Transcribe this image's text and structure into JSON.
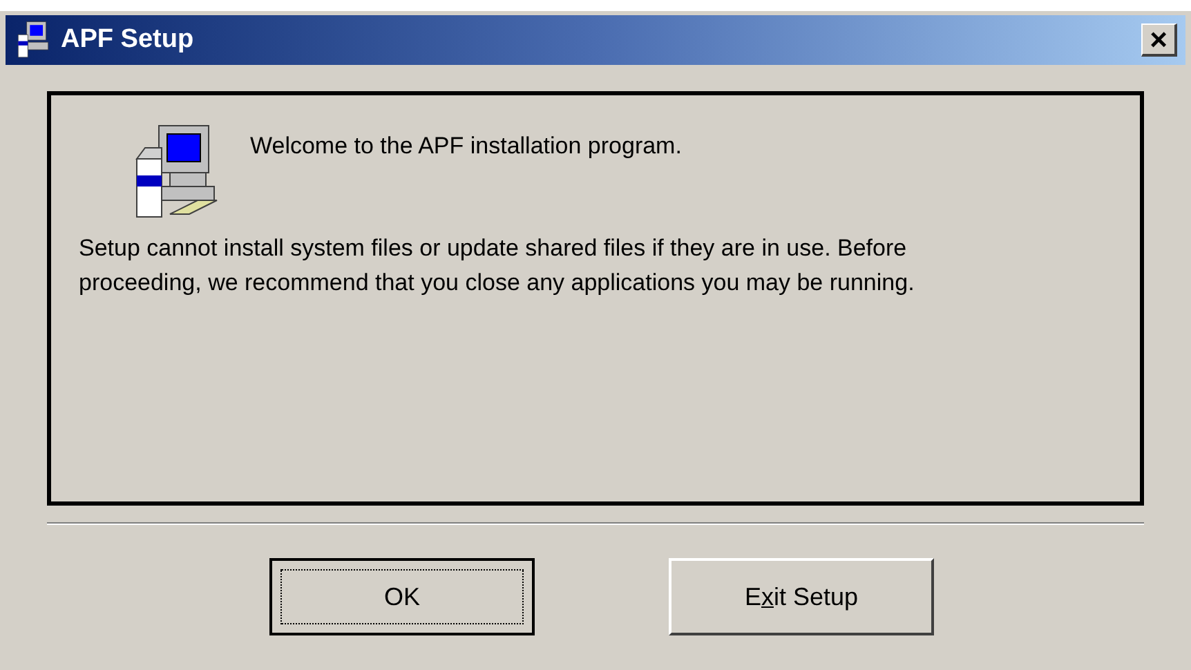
{
  "window": {
    "title": "APF Setup",
    "close": "×"
  },
  "welcome": "Welcome to the APF installation program.",
  "message": "Setup cannot install system files or update shared files if they are in use. Before proceeding, we recommend that you close any applications you may be running.",
  "buttons": [
    {
      "kind": "default",
      "label": "OK"
    },
    {
      "kind": "accelerator",
      "before": "E",
      "key": "x",
      "after": "it Setup"
    }
  ]
}
